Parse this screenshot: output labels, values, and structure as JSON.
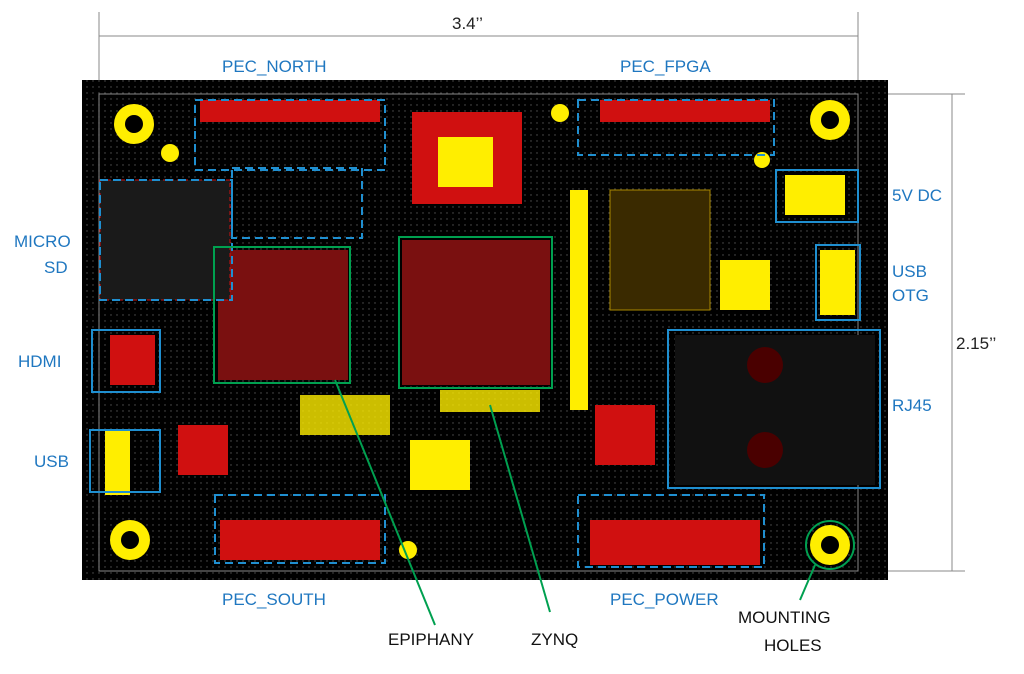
{
  "dimensions": {
    "width_label": "3.4’’",
    "height_label": "2.15’’"
  },
  "regions": {
    "pec_north": "PEC_NORTH",
    "pec_fpga": "PEC_FPGA",
    "pec_south": "PEC_SOUTH",
    "pec_power": "PEC_POWER",
    "micro_sd": [
      "MICRO",
      "SD"
    ],
    "hdmi": "HDMI",
    "usb": "USB",
    "dc_5v": "5V DC",
    "usb_otg": [
      "USB",
      "OTG"
    ],
    "rj45": "RJ45"
  },
  "callouts": {
    "epiphany": "EPIPHANY",
    "zynq": "ZYNQ",
    "mounting_holes": [
      "MOUNTING",
      "HOLES"
    ]
  },
  "colors": {
    "board": "#000000",
    "pads": "#ffee00",
    "traces": "#d01010",
    "region_outline": "#1f8fd0",
    "callout": "#00a050",
    "label": "#1f77c0"
  }
}
